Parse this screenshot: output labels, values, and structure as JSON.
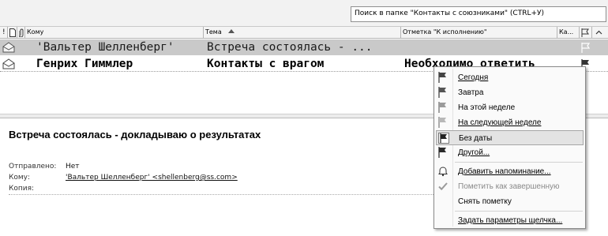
{
  "search": {
    "placeholder": "Поиск в папке \"Контакты с союзниками\" (CTRL+У)"
  },
  "columns": {
    "importance_glyph": "!",
    "type_glyph": "▢",
    "attachment_glyph": "0",
    "to": "Кому",
    "subject": "Тема",
    "flag_status": "Отметка \"К исполнению\"",
    "category": "Ка..."
  },
  "messages": [
    {
      "to": "'Вальтер Шелленберг'",
      "subject": "Встреча состоялась - ...",
      "flag_status": "",
      "read": true
    },
    {
      "to": "Генрих Гиммлер",
      "subject": "Контакты с врагом",
      "flag_status": "Необходимо ответить",
      "read": false
    }
  ],
  "reading_pane": {
    "subject": "Встреча состоялась - докладываю о результатах",
    "sent_label": "Отправлено:",
    "sent_value": "Нет",
    "to_label": "Кому:",
    "to_value": "'Вальтер Шелленберг' <shellenberg@ss.com>",
    "cc_label": "Копия:"
  },
  "flag_menu": {
    "items": [
      {
        "label": "Сегодня",
        "icon": "flag-red-icon"
      },
      {
        "label": "Завтра",
        "icon": "flag-red-icon"
      },
      {
        "label": "На этой неделе",
        "icon": "flag-light-icon"
      },
      {
        "label": "На следующей неделе",
        "icon": "flag-light-icon"
      },
      {
        "label": "Без даты",
        "icon": "flag-dark-icon",
        "selected": true
      },
      {
        "label": "Другой...",
        "icon": "flag-dark-icon"
      },
      {
        "label": "Добавить напоминание...",
        "icon": "bell-icon"
      },
      {
        "label": "Пометить как завершенную",
        "icon": "checkmark-icon",
        "disabled": true
      },
      {
        "label": "Снять пометку",
        "icon": ""
      },
      {
        "label": "Задать параметры щелчка...",
        "icon": ""
      }
    ]
  }
}
